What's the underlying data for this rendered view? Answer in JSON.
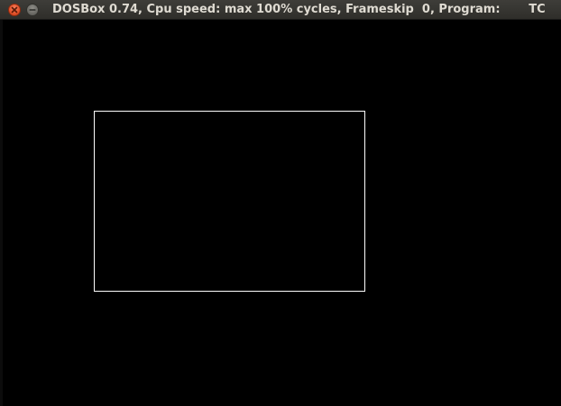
{
  "window": {
    "title": "DOSBox 0.74, Cpu speed: max 100% cycles, Frameskip  0, Program:       TC",
    "controls": {
      "close_icon": "close-icon",
      "minimize_icon": "minimize-icon"
    }
  },
  "display": {
    "background_color": "#000000",
    "shape": {
      "kind": "rectangle-outline",
      "stroke_color": "#ffffff"
    }
  }
}
